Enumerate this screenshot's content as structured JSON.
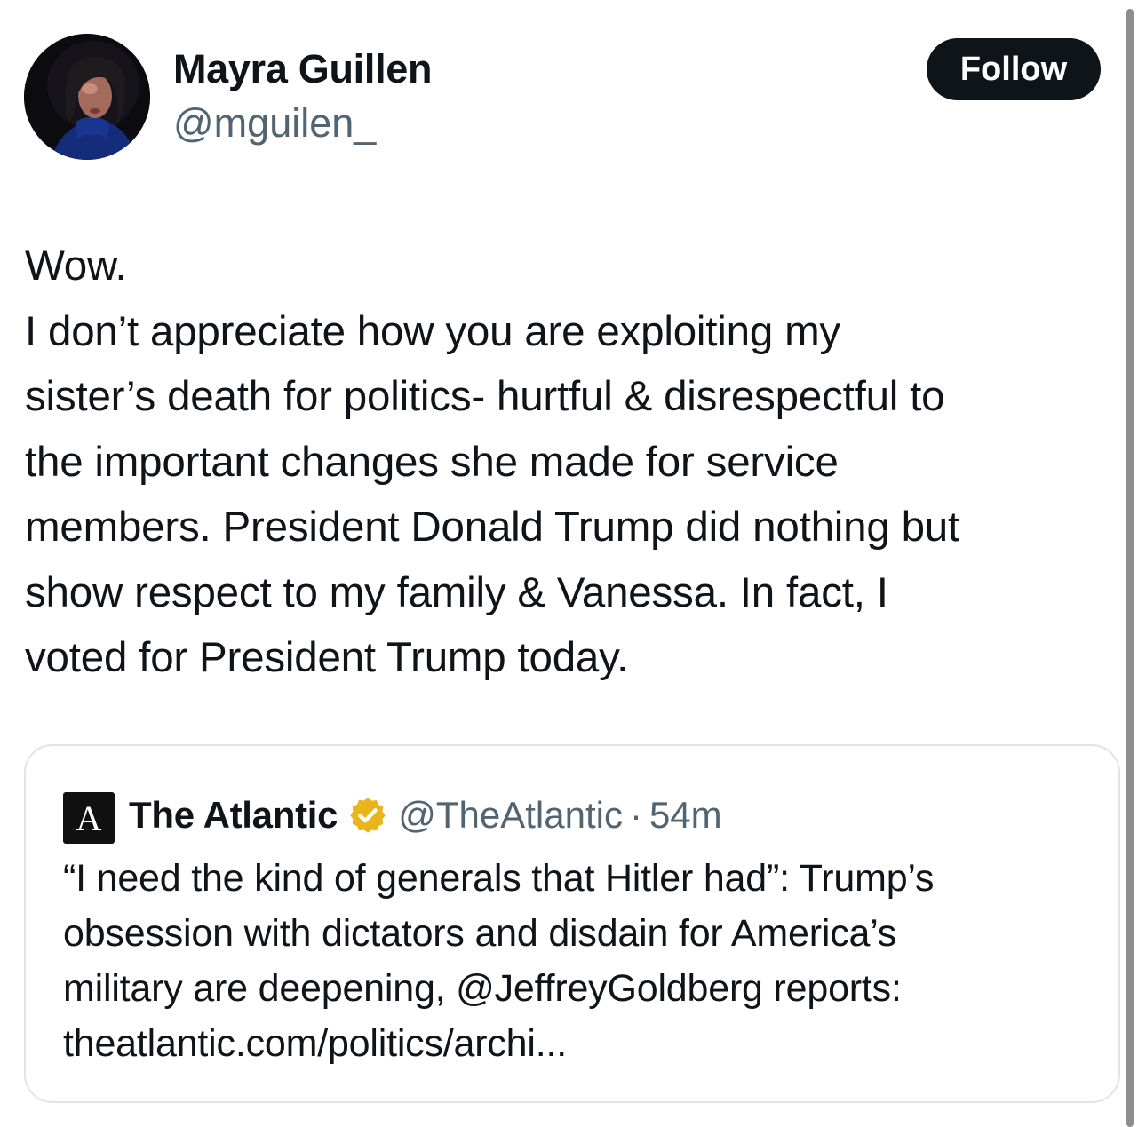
{
  "author": {
    "name": "Mayra Guillen",
    "handle": "@mguilen_",
    "avatar_icon": "profile-photo"
  },
  "follow_label": "Follow",
  "tweet": {
    "lines": [
      "Wow.",
      "I don’t appreciate how you are exploiting my",
      "sister’s death for politics- hurtful & disrespectful to",
      "the important changes she made for service",
      "members. President Donald Trump did nothing but",
      "show respect to my family & Vanessa. In fact, I",
      "voted for President Trump today."
    ]
  },
  "quote": {
    "logo_letter": "A",
    "name": "The Atlantic",
    "verified_icon": "gold-verified-badge",
    "handle": "@TheAtlantic",
    "separator": "·",
    "time": "54m",
    "lines": [
      "“I need the kind of generals that Hitler had”: Trump’s",
      "obsession with dictators and disdain for America’s",
      "military are deepening, @JeffreyGoldberg reports:",
      "theatlantic.com/politics/archi..."
    ]
  },
  "colors": {
    "text": "#0f1419",
    "secondary": "#536471",
    "button": "#0f1419",
    "badge": "#e8b51c",
    "border": "#e1e5e8"
  }
}
